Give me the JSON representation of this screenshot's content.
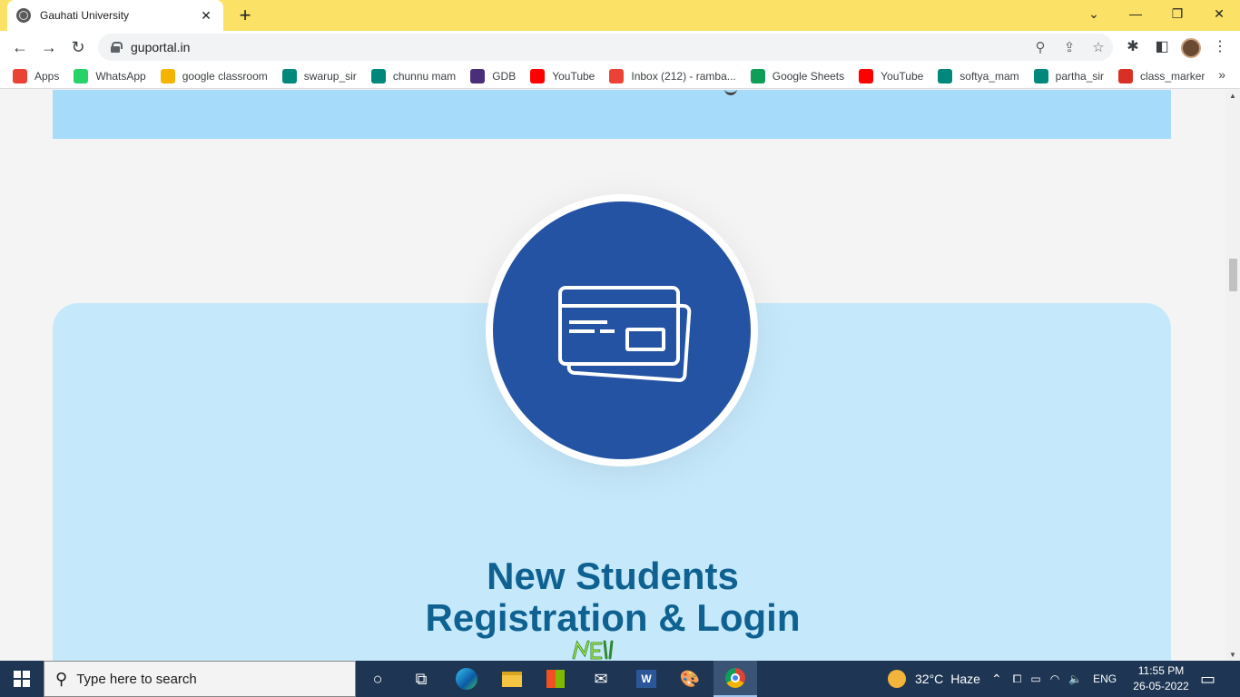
{
  "browser": {
    "tab_title": "Gauhati University",
    "tab_close": "✕",
    "new_tab": "+",
    "window_controls": [
      "⌄",
      "—",
      "❐",
      "✕"
    ],
    "url": "guportal.in"
  },
  "bookmarks": [
    {
      "label": "Apps",
      "icon": "apps-grid-icon",
      "color": "#ea4335"
    },
    {
      "label": "WhatsApp",
      "icon": "whatsapp-icon",
      "color": "#25d366"
    },
    {
      "label": "google classroom",
      "icon": "google-classroom-icon",
      "color": "#f4b400"
    },
    {
      "label": "swarup_sir",
      "icon": "google-meet-icon",
      "color": "#00897b"
    },
    {
      "label": "chunnu mam",
      "icon": "google-meet-icon",
      "color": "#00897b"
    },
    {
      "label": "GDB",
      "icon": "gdb-icon",
      "color": "#4a2e7a"
    },
    {
      "label": "YouTube",
      "icon": "youtube-icon",
      "color": "#ff0000"
    },
    {
      "label": "Inbox (212) - ramba...",
      "icon": "gmail-icon",
      "color": "#ea4335"
    },
    {
      "label": "Google Sheets",
      "icon": "google-sheets-icon",
      "color": "#0f9d58"
    },
    {
      "label": "YouTube",
      "icon": "youtube-icon",
      "color": "#ff0000"
    },
    {
      "label": "softya_mam",
      "icon": "google-meet-icon",
      "color": "#00897b"
    },
    {
      "label": "partha_sir",
      "icon": "google-meet-icon",
      "color": "#00897b"
    },
    {
      "label": "class_marker",
      "icon": "checkmark-icon",
      "color": "#d93025"
    }
  ],
  "bookmarks_more": "»",
  "page": {
    "card_title_line1": "New Students",
    "card_title_line2": "Registration & Login",
    "card_icon": "credit-card-icon",
    "colors": {
      "band": "#a6dcfa",
      "card": "#c5e9fb",
      "circle": "#2453a3",
      "title": "#0f6192"
    }
  },
  "taskbar": {
    "search_placeholder": "Type here to search",
    "weather_temp": "32°C",
    "weather_desc": "Haze",
    "language": "ENG",
    "time": "11:55 PM",
    "date": "26-05-2022"
  }
}
